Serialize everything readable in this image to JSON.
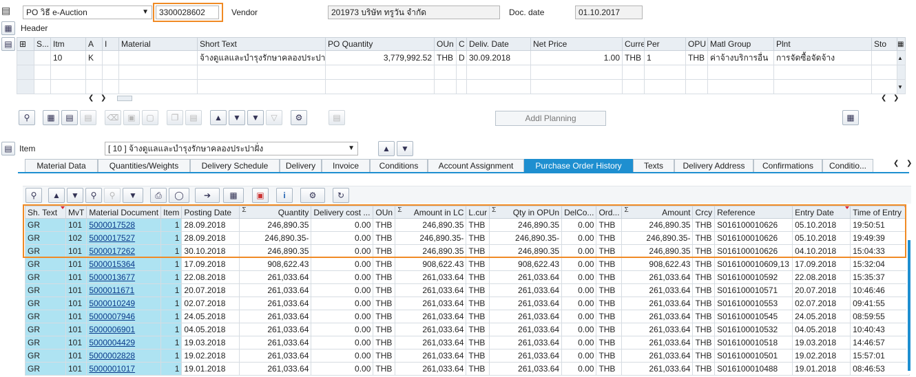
{
  "header": {
    "doc_type": "PO วิธี e-Auction",
    "po_number": "3300028602",
    "vendor_label": "Vendor",
    "vendor_value": "201973 บริษัท ทรูวัน จำกัด",
    "doc_date_label": "Doc. date",
    "doc_date_value": "01.10.2017",
    "header_label": "Header"
  },
  "items": {
    "columns": [
      "S...",
      "Itm",
      "A",
      "I",
      "Material",
      "Short Text",
      "PO Quantity",
      "OUn",
      "C",
      "Deliv. Date",
      "Net Price",
      "Curre",
      "Per",
      "OPU",
      "Matl Group",
      "Plnt",
      "Sto"
    ],
    "rows": [
      [
        "",
        "10",
        "K",
        "",
        "",
        "จ้างดูแลและบำรุงรักษาคลองประปาฝั่ง",
        "3,779,992.52",
        "THB",
        "D",
        "30.09.2018",
        "1.00",
        "THB",
        "1",
        "THB",
        "ค่าจ้างบริการอื่น",
        "การจัดซื้อจัดจ้าง",
        ""
      ]
    ],
    "addl_planning": "Addl Planning"
  },
  "item_detail": {
    "label": "Item",
    "selected": "[ 10 ] จ้างดูแลและบำรุงรักษาคลองประปาฝั่ง"
  },
  "tabs": [
    "Material Data",
    "Quantities/Weights",
    "Delivery Schedule",
    "Delivery",
    "Invoice",
    "Conditions",
    "Account Assignment",
    "Purchase Order History",
    "Texts",
    "Delivery Address",
    "Confirmations",
    "Conditio..."
  ],
  "active_tab": "Purchase Order History",
  "history": {
    "columns": [
      "Sh. Text",
      "MvT",
      "Material Document",
      "Item",
      "Posting Date",
      "Quantity",
      "Delivery cost ...",
      "OUn",
      "Amount in LC",
      "L.cur",
      "Qty in OPUn",
      "DelCo...",
      "Ord...",
      "Amount",
      "Crcy",
      "Reference",
      "Entry Date",
      "Time of Entry"
    ],
    "rows": [
      [
        "GR",
        "101",
        "5000017528",
        "1",
        "28.09.2018",
        "246,890.35",
        "0.00",
        "THB",
        "246,890.35",
        "THB",
        "246,890.35",
        "0.00",
        "THB",
        "246,890.35",
        "THB",
        "S016100010626",
        "05.10.2018",
        "19:50:51"
      ],
      [
        "GR",
        "102",
        "5000017527",
        "1",
        "28.09.2018",
        "246,890.35-",
        "0.00",
        "THB",
        "246,890.35-",
        "THB",
        "246,890.35-",
        "0.00",
        "THB",
        "246,890.35-",
        "THB",
        "S016100010626",
        "05.10.2018",
        "19:49:39"
      ],
      [
        "GR",
        "101",
        "5000017262",
        "1",
        "30.10.2018",
        "246,890.35",
        "0.00",
        "THB",
        "246,890.35",
        "THB",
        "246,890.35",
        "0.00",
        "THB",
        "246,890.35",
        "THB",
        "S016100010626",
        "04.10.2018",
        "15:04:33"
      ],
      [
        "GR",
        "101",
        "5000015364",
        "1",
        "17.09.2018",
        "908,622.43",
        "0.00",
        "THB",
        "908,622.43",
        "THB",
        "908,622.43",
        "0.00",
        "THB",
        "908,622.43",
        "THB",
        "S016100010609,13",
        "17.09.2018",
        "15:32:04"
      ],
      [
        "GR",
        "101",
        "5000013677",
        "1",
        "22.08.2018",
        "261,033.64",
        "0.00",
        "THB",
        "261,033.64",
        "THB",
        "261,033.64",
        "0.00",
        "THB",
        "261,033.64",
        "THB",
        "S016100010592",
        "22.08.2018",
        "15:35:37"
      ],
      [
        "GR",
        "101",
        "5000011671",
        "1",
        "20.07.2018",
        "261,033.64",
        "0.00",
        "THB",
        "261,033.64",
        "THB",
        "261,033.64",
        "0.00",
        "THB",
        "261,033.64",
        "THB",
        "S016100010571",
        "20.07.2018",
        "10:46:46"
      ],
      [
        "GR",
        "101",
        "5000010249",
        "1",
        "02.07.2018",
        "261,033.64",
        "0.00",
        "THB",
        "261,033.64",
        "THB",
        "261,033.64",
        "0.00",
        "THB",
        "261,033.64",
        "THB",
        "S016100010553",
        "02.07.2018",
        "09:41:55"
      ],
      [
        "GR",
        "101",
        "5000007946",
        "1",
        "24.05.2018",
        "261,033.64",
        "0.00",
        "THB",
        "261,033.64",
        "THB",
        "261,033.64",
        "0.00",
        "THB",
        "261,033.64",
        "THB",
        "S016100010545",
        "24.05.2018",
        "08:59:55"
      ],
      [
        "GR",
        "101",
        "5000006901",
        "1",
        "04.05.2018",
        "261,033.64",
        "0.00",
        "THB",
        "261,033.64",
        "THB",
        "261,033.64",
        "0.00",
        "THB",
        "261,033.64",
        "THB",
        "S016100010532",
        "04.05.2018",
        "10:40:43"
      ],
      [
        "GR",
        "101",
        "5000004429",
        "1",
        "19.03.2018",
        "261,033.64",
        "0.00",
        "THB",
        "261,033.64",
        "THB",
        "261,033.64",
        "0.00",
        "THB",
        "261,033.64",
        "THB",
        "S016100010518",
        "19.03.2018",
        "14:46:57"
      ],
      [
        "GR",
        "101",
        "5000002828",
        "1",
        "19.02.2018",
        "261,033.64",
        "0.00",
        "THB",
        "261,033.64",
        "THB",
        "261,033.64",
        "0.00",
        "THB",
        "261,033.64",
        "THB",
        "S016100010501",
        "19.02.2018",
        "15:57:01"
      ],
      [
        "GR",
        "101",
        "5000001017",
        "1",
        "19.01.2018",
        "261,033.64",
        "0.00",
        "THB",
        "261,033.64",
        "THB",
        "261,033.64",
        "0.00",
        "THB",
        "261,033.64",
        "THB",
        "S016100010488",
        "19.01.2018",
        "08:46:53"
      ]
    ]
  },
  "colors": {
    "accent": "#1e8fd0",
    "highlight": "#f08a24",
    "key_column": "#aee3f2"
  }
}
